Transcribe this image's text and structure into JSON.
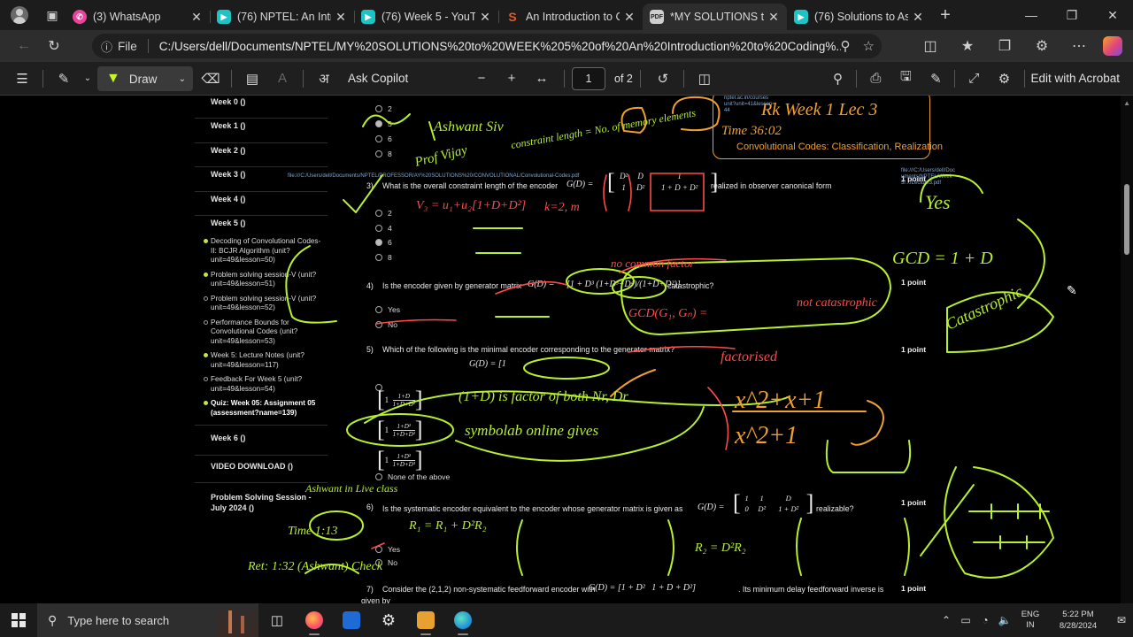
{
  "browser": {
    "tabs": [
      {
        "title": "(3) WhatsApp",
        "favicon": "whatsapp-icon",
        "color": "#e8449a",
        "active": false
      },
      {
        "title": "(76) NPTEL: An Introdu",
        "favicon": "youtube-icon",
        "color": "#1ec3c3",
        "active": false
      },
      {
        "title": "(76) Week 5 - YouTub",
        "favicon": "youtube-icon",
        "color": "#1ec3c3",
        "active": false
      },
      {
        "title": "An Introduction to Co",
        "favicon": "scribd-icon",
        "color": "#e05a2b",
        "active": false
      },
      {
        "title": "*MY SOLUTIONS to W",
        "favicon": "pdf-icon",
        "color": "#cfcfcf",
        "active": true
      },
      {
        "title": "(76) Solutions to Ass",
        "favicon": "youtube-icon",
        "color": "#1ec3c3",
        "active": false
      }
    ],
    "address": {
      "scheme_label": "File",
      "url": "C:/Users/dell/Documents/NPTEL/MY%20SOLUTIONS%20to%20WEEK%205%20of%20An%20Introduction%20to%20Coding%..."
    }
  },
  "pdf_toolbar": {
    "draw_label": "Draw",
    "copilot_label": "Ask Copilot",
    "current_page": "1",
    "page_total": "of 2",
    "acrobat_label": "Edit with Acrobat"
  },
  "sidebar": {
    "week0": "Week 0 ()",
    "week1": "Week 1 ()",
    "week2": "Week 2 ()",
    "week3": "Week 3 ()",
    "week4": "Week 4 ()",
    "week5": "Week 5 ()",
    "week5_items": [
      "Decoding of Convolutional Codes-II: BCJR Algorithm (unit?unit=49&lesson=50)",
      "Problem solving session-V (unit?unit=49&lesson=51)",
      "Problem solving session-V (unit?unit=49&lesson=52)",
      "Performance Bounds for Convolutional Codes (unit?unit=49&lesson=53)",
      "Week 5: Lecture Notes (unit?unit=49&lesson=117)",
      "Feedback For Week 5 (unit?unit=49&lesson=54)",
      "Quiz: Week 05: Assignment 05 (assessment?name=139)"
    ],
    "week6": "Week 6 ()",
    "video": "VIDEO DOWNLOAD ()",
    "problem": "Problem Solving Session - July 2024 ()"
  },
  "doc": {
    "q2_options": [
      "2",
      "5",
      "6",
      "8"
    ],
    "q3": {
      "number": "3)",
      "text": "What is the overall constraint length of the encoder",
      "text_after": "realized in observer canonical form",
      "options": [
        "2",
        "4",
        "6",
        "8"
      ],
      "points": "1 point"
    },
    "q4": {
      "number": "4)",
      "text": "Is the encoder given by generator matrix",
      "text_after": "catastrophic?",
      "options": [
        "Yes",
        "No"
      ],
      "points": "1 point"
    },
    "q5": {
      "number": "5)",
      "text": "Which of the following is the minimal encoder corresponding to the generator matrix?",
      "none_option": "None of the above",
      "points": "1 point"
    },
    "q6": {
      "number": "6)",
      "text": "Is the systematic encoder equivalent to the encoder whose generator matrix is given as",
      "text_after": "realizable?",
      "options": [
        "Yes",
        "No"
      ],
      "points": "1 point"
    },
    "q7": {
      "number": "7)",
      "text": "Consider the (2,1,2) non-systematic feedforward encoder with",
      "text_after": ". Its minimum delay feedforward inverse is",
      "text_line2": "given by",
      "points": "1 point"
    },
    "orange_note": "Convolutional Codes: Classification, Realization",
    "math": {
      "GD": "G(D) =",
      "q4_matrix": "[1 + D³   (1+D³+D⁴)/(1+D+D²)]",
      "q5_G": "G(D) = [1",
      "q6_G": "G(D) ="
    }
  },
  "ink": {
    "orange_big_1": "x^2+x+1",
    "orange_big_2": "x^2+1",
    "factored": "factorised",
    "symbolab": "symbolab online gives",
    "factor_note": "(1+D) is factor of both Nr, Dr",
    "gcd": "GCD(G₁, Gₙ) =",
    "not_catastrophic": "not catastrophic",
    "no_common": "no common factor",
    "yes": "Yes",
    "ret_check": "Ret: 1:32 (Ashwant) Check",
    "ashwant_live": "Ashwant in Live class",
    "time_13": "Time 1:13",
    "rk_week": "Rk Week 1 Lec 3",
    "time_3602": "Time 36:02",
    "catastrophic": "Catastrophic",
    "gcd_right": "GCD = 1 + D",
    "ashwant_siv": "Ashwant Siv",
    "prof_vijay": "Prof Vijay",
    "constraint_length": "constraint length = No. of memory elements",
    "v3_eq": "V₃ = u₁+u₂[1+D+D²]",
    "k_eq": "k=2, m",
    "r1_eq": "R₁ = R₁ + D²R₂",
    "r2_eq": "R₂ = D²R₂"
  },
  "taskbar": {
    "search_placeholder": "Type here to search",
    "lang_1": "ENG",
    "lang_2": "IN",
    "time": "5:22 PM",
    "date": "8/28/2024"
  }
}
